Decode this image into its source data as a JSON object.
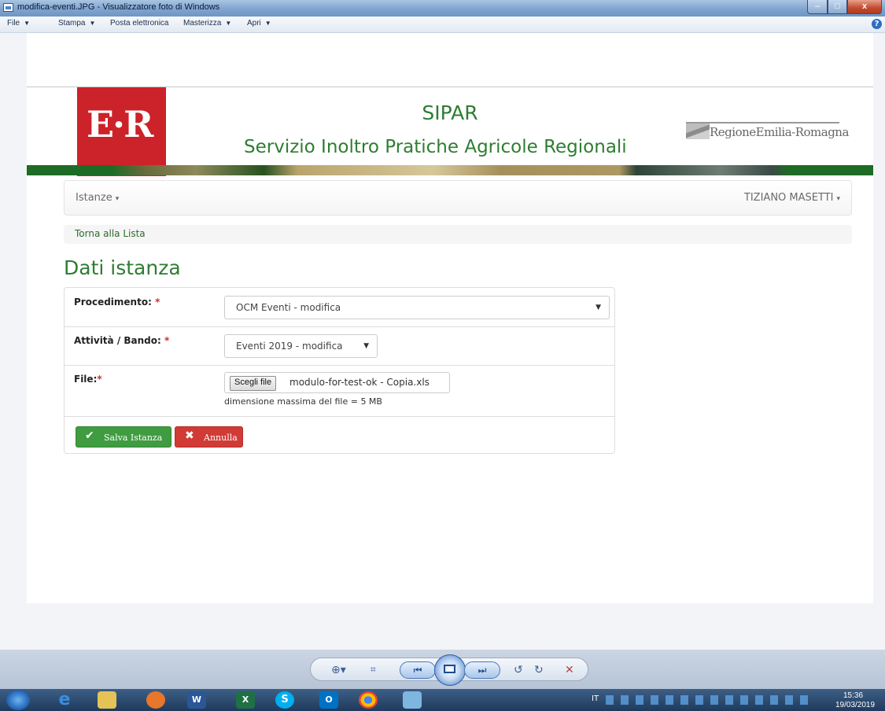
{
  "window": {
    "title": "modifica-eventi.JPG - Visualizzatore foto di Windows",
    "minimize": "–",
    "maximize": "□",
    "close": "x"
  },
  "menubar": {
    "items": [
      "File",
      "Stampa",
      "Posta elettronica",
      "Masterizza",
      "Apri"
    ],
    "help": "?"
  },
  "banner": {
    "logo_text": "E·R",
    "title": "SIPAR",
    "subtitle": "Servizio Inoltro Pratiche Agricole Regionali",
    "region_name": "RegioneEmilia-Romagna"
  },
  "navbar": {
    "left_menu": "Istanze",
    "user": "TIZIANO MASETTI",
    "caret": "▾"
  },
  "breadcrumb": {
    "back_link": "Torna alla Lista"
  },
  "page": {
    "title": "Dati istanza"
  },
  "form": {
    "procedimento_label": "Procedimento:",
    "procedimento_value": "OCM Eventi - modifica",
    "attivita_label": "Attività / Bando:",
    "attivita_value": "Eventi 2019 - modifica",
    "file_label": "File:",
    "file_button": "Scegli file",
    "file_name": "modulo-for-test-ok - Copia.xls",
    "file_help": "dimensione massima del file = 5 MB",
    "required_mark": "*",
    "save_label": "Salva Istanza",
    "cancel_label": "Annulla"
  },
  "taskbar": {
    "language": "IT",
    "time": "15:36",
    "date": "19/03/2019"
  },
  "colors": {
    "brand_green": "#2e7d32",
    "logo_red": "#cc2229",
    "save_button": "#3f9c40",
    "cancel_button": "#d13b36"
  },
  "icons": [
    "app-icon",
    "help-icon",
    "caret-down-icon",
    "check-icon",
    "times-icon",
    "zoom-icon",
    "fit-icon",
    "prev-icon",
    "slideshow-icon",
    "next-icon",
    "rotate-left-icon",
    "rotate-right-icon",
    "delete-icon",
    "start-icon"
  ]
}
